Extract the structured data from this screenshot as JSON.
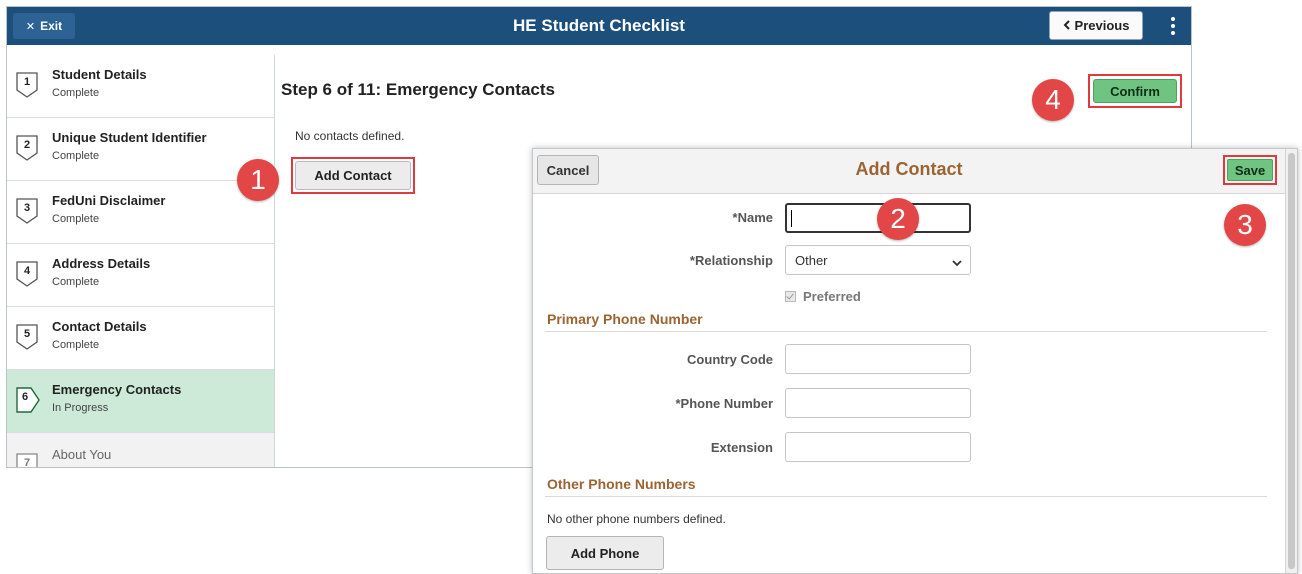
{
  "header": {
    "exit_label": "Exit",
    "title": "HE Student Checklist",
    "previous_label": "Previous"
  },
  "sidebar": {
    "steps": [
      {
        "number": "1",
        "title": "Student Details",
        "status": "Complete"
      },
      {
        "number": "2",
        "title": "Unique Student Identifier",
        "status": "Complete"
      },
      {
        "number": "3",
        "title": "FedUni Disclaimer",
        "status": "Complete"
      },
      {
        "number": "4",
        "title": "Address Details",
        "status": "Complete"
      },
      {
        "number": "5",
        "title": "Contact Details",
        "status": "Complete"
      },
      {
        "number": "6",
        "title": "Emergency Contacts",
        "status": "In Progress"
      },
      {
        "number": "7",
        "title": "About You",
        "status": ""
      }
    ]
  },
  "main": {
    "step_heading": "Step 6 of 11: Emergency Contacts",
    "no_contacts_text": "No contacts defined.",
    "add_contact_label": "Add Contact",
    "confirm_label": "Confirm"
  },
  "annotations": {
    "one": "1",
    "two": "2",
    "three": "3",
    "four": "4"
  },
  "modal": {
    "cancel_label": "Cancel",
    "title": "Add Contact",
    "save_label": "Save",
    "name_label": "*Name",
    "name_value": "",
    "relationship_label": "*Relationship",
    "relationship_value": "Other",
    "preferred_label": "Preferred",
    "primary_phone_title": "Primary Phone Number",
    "country_code_label": "Country Code",
    "phone_number_label": "*Phone Number",
    "extension_label": "Extension",
    "other_phones_title": "Other Phone Numbers",
    "no_other_phones_text": "No other phone numbers defined.",
    "add_phone_label": "Add Phone"
  },
  "colors": {
    "header_bg": "#1d4f7c",
    "active_step_bg": "#cdead9",
    "confirm_green": "#6fc482",
    "highlight_red": "#e0393e",
    "section_title_brown": "#9c6433"
  },
  "icons": {
    "exit": "close-icon",
    "previous": "chevron-left-icon",
    "menu": "kebab-menu-icon",
    "select": "chevron-down-icon"
  }
}
